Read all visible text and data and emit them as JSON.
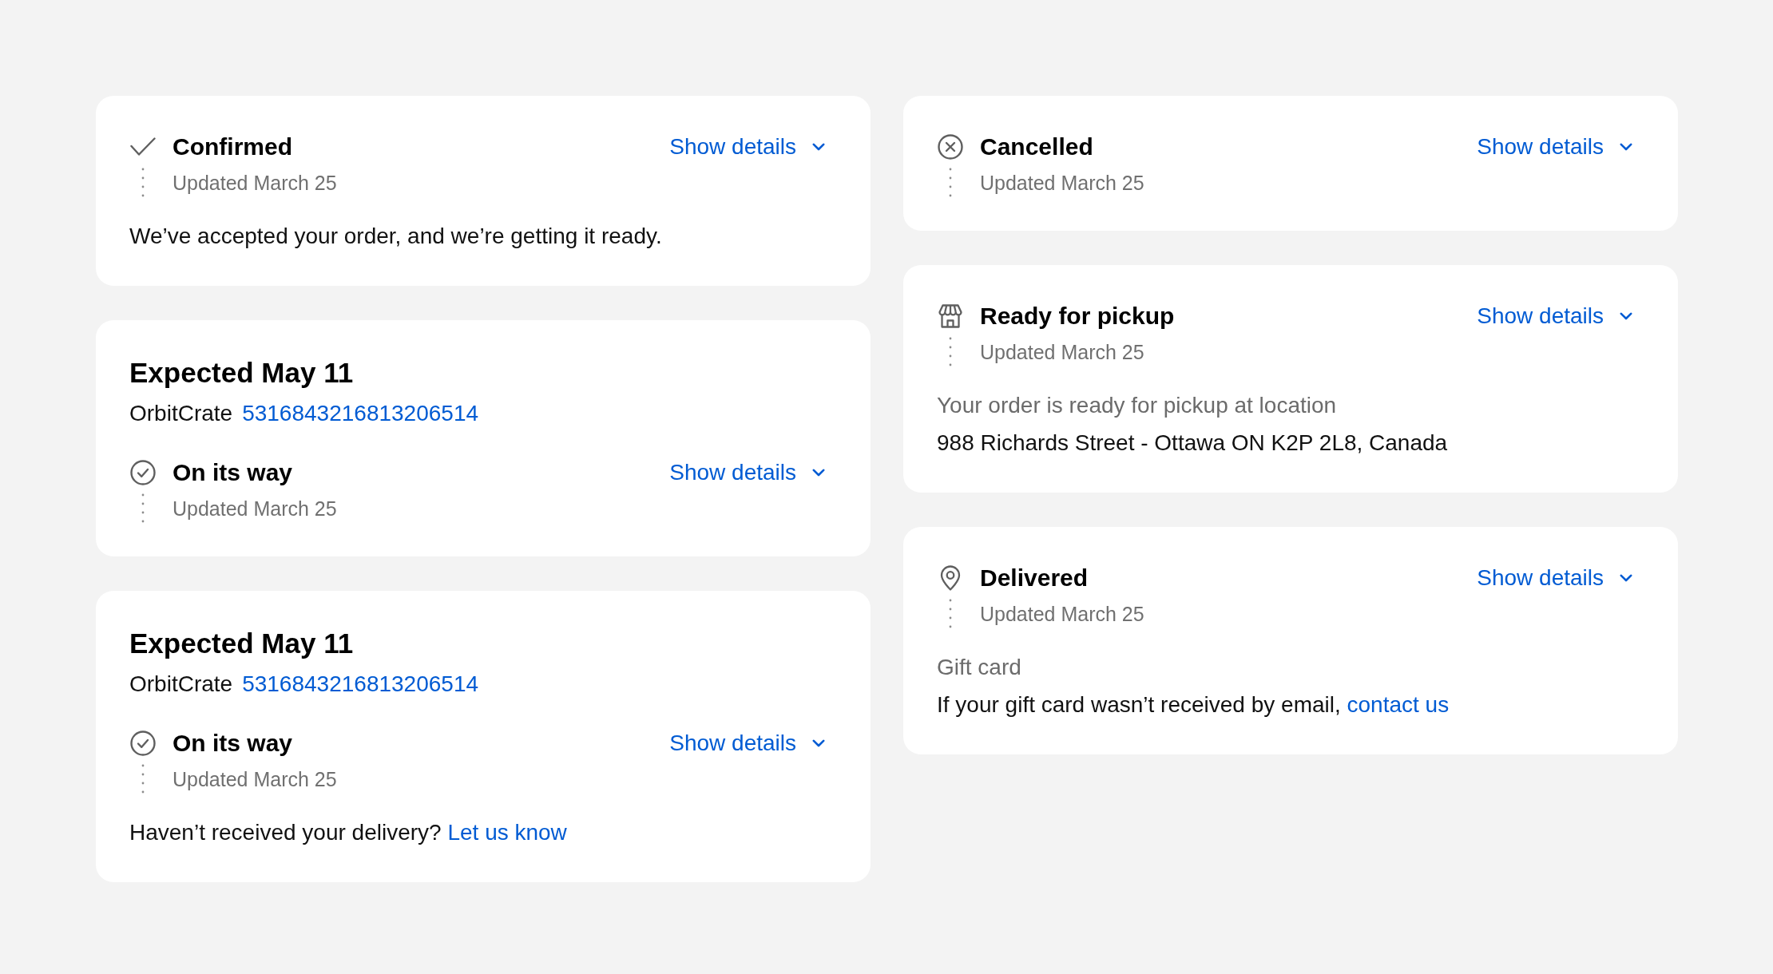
{
  "columns": [
    {
      "cards": [
        {
          "status": {
            "kind": "confirmed",
            "title": "Confirmed",
            "updated": "Updated March 25",
            "toggle": "Show details"
          },
          "body": [
            {
              "kind": "text",
              "text": "We’ve accepted your order, and we’re getting it ready."
            }
          ]
        },
        {
          "heading": "Expected May 11",
          "carrier": "OrbitCrate",
          "tracking_number": "5316843216813206514",
          "status": {
            "kind": "in_transit",
            "title": "On its way",
            "updated": "Updated March 25",
            "toggle": "Show details"
          }
        },
        {
          "heading": "Expected May 11",
          "carrier": "OrbitCrate",
          "tracking_number": "5316843216813206514",
          "status": {
            "kind": "in_transit",
            "title": "On its way",
            "updated": "Updated March 25",
            "toggle": "Show details"
          },
          "body": [
            {
              "kind": "text_with_link",
              "text": "Haven’t received your delivery?",
              "link": "Let us know"
            }
          ]
        }
      ]
    },
    {
      "cards": [
        {
          "status": {
            "kind": "cancelled",
            "title": "Cancelled",
            "updated": "Updated March 25",
            "toggle": "Show details"
          }
        },
        {
          "status": {
            "kind": "ready_for_pickup",
            "title": "Ready for pickup",
            "updated": "Updated March 25",
            "toggle": "Show details"
          },
          "body": [
            {
              "kind": "note",
              "text": "Your order is ready for pickup at location"
            },
            {
              "kind": "text",
              "text": "988 Richards Street - Ottawa ON K2P 2L8, Canada"
            }
          ]
        },
        {
          "status": {
            "kind": "delivered",
            "title": "Delivered",
            "updated": "Updated March 25",
            "toggle": "Show details"
          },
          "body": [
            {
              "kind": "note",
              "text": "Gift card"
            },
            {
              "kind": "text_with_link",
              "text": "If your gift card wasn’t received by email,",
              "link": "contact us"
            }
          ]
        }
      ]
    }
  ]
}
